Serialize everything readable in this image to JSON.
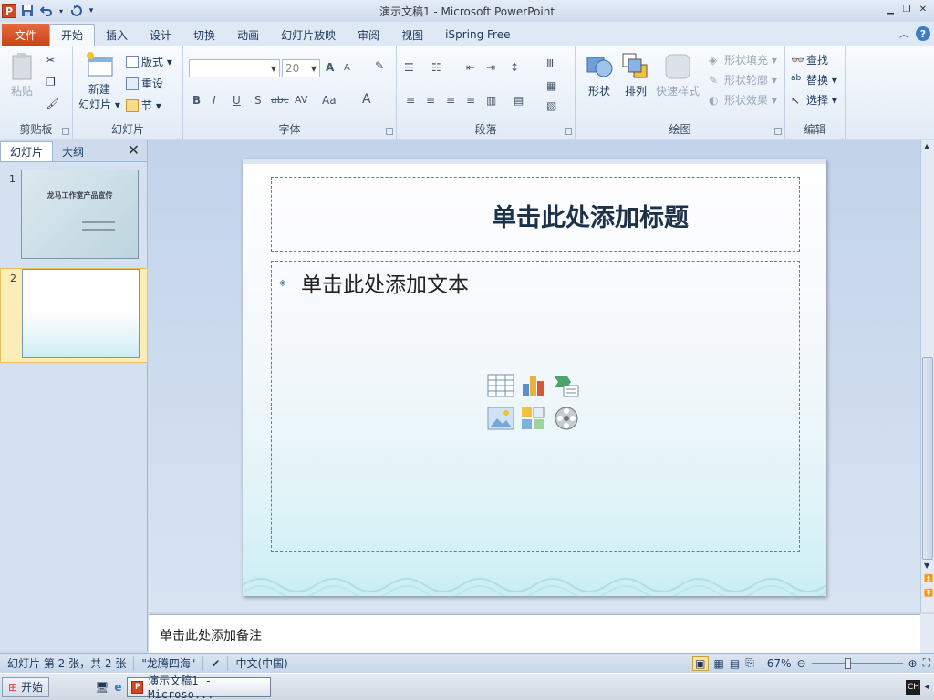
{
  "window": {
    "title": "演示文稿1 - Microsoft PowerPoint"
  },
  "qat": {
    "app": "P",
    "save": "save-icon",
    "undo": "undo-icon",
    "redo": "redo-icon",
    "customize": "▾"
  },
  "tabs": {
    "file": "文件",
    "items": [
      "开始",
      "插入",
      "设计",
      "切换",
      "动画",
      "幻灯片放映",
      "审阅",
      "视图",
      "iSpring Free"
    ],
    "active": "开始",
    "help": "?"
  },
  "ribbon": {
    "clipboard": {
      "label": "剪贴板",
      "paste": "粘贴"
    },
    "slides": {
      "label": "幻灯片",
      "new_slide_1": "新建",
      "new_slide_2": "幻灯片 ▾",
      "layout": "版式 ▾",
      "reset": "重设",
      "section": "节 ▾"
    },
    "font": {
      "label": "字体",
      "font_name": "",
      "font_size": "20",
      "bold": "B",
      "italic": "I",
      "underline": "U",
      "shadow": "S",
      "strike": "abc",
      "spacing": "AV",
      "case": "Aa",
      "color": "A",
      "grow": "A",
      "shrink": "A"
    },
    "paragraph": {
      "label": "段落"
    },
    "drawing": {
      "label": "绘图",
      "shapes": "形状",
      "arrange": "排列",
      "quick_styles": "快速样式",
      "fill": "形状填充 ▾",
      "outline": "形状轮廓 ▾",
      "effects": "形状效果 ▾"
    },
    "editing": {
      "label": "编辑",
      "find": "查找",
      "replace": "替换 ▾",
      "select": "选择 ▾"
    }
  },
  "panel": {
    "tabs": [
      "幻灯片",
      "大纲"
    ],
    "close": "✕",
    "slides": [
      {
        "num": "1",
        "title": "龙马工作室产品宣传"
      },
      {
        "num": "2",
        "title": ""
      }
    ]
  },
  "slide": {
    "title": "单击此处添加标题",
    "body": "单击此处添加文本"
  },
  "notes": {
    "placeholder": "单击此处添加备注"
  },
  "status": {
    "slide_info": "幻灯片 第 2 张，共 2 张",
    "theme": "\"龙腾四海\"",
    "language": "中文(中国)",
    "zoom": "67%",
    "zoom_level": 0.67
  },
  "taskbar": {
    "start": "开始",
    "window": "演示文稿1 - Microso...",
    "ime": "CH"
  },
  "colors": {
    "file_tab": "#c9431b",
    "accent": "#1e395b"
  }
}
